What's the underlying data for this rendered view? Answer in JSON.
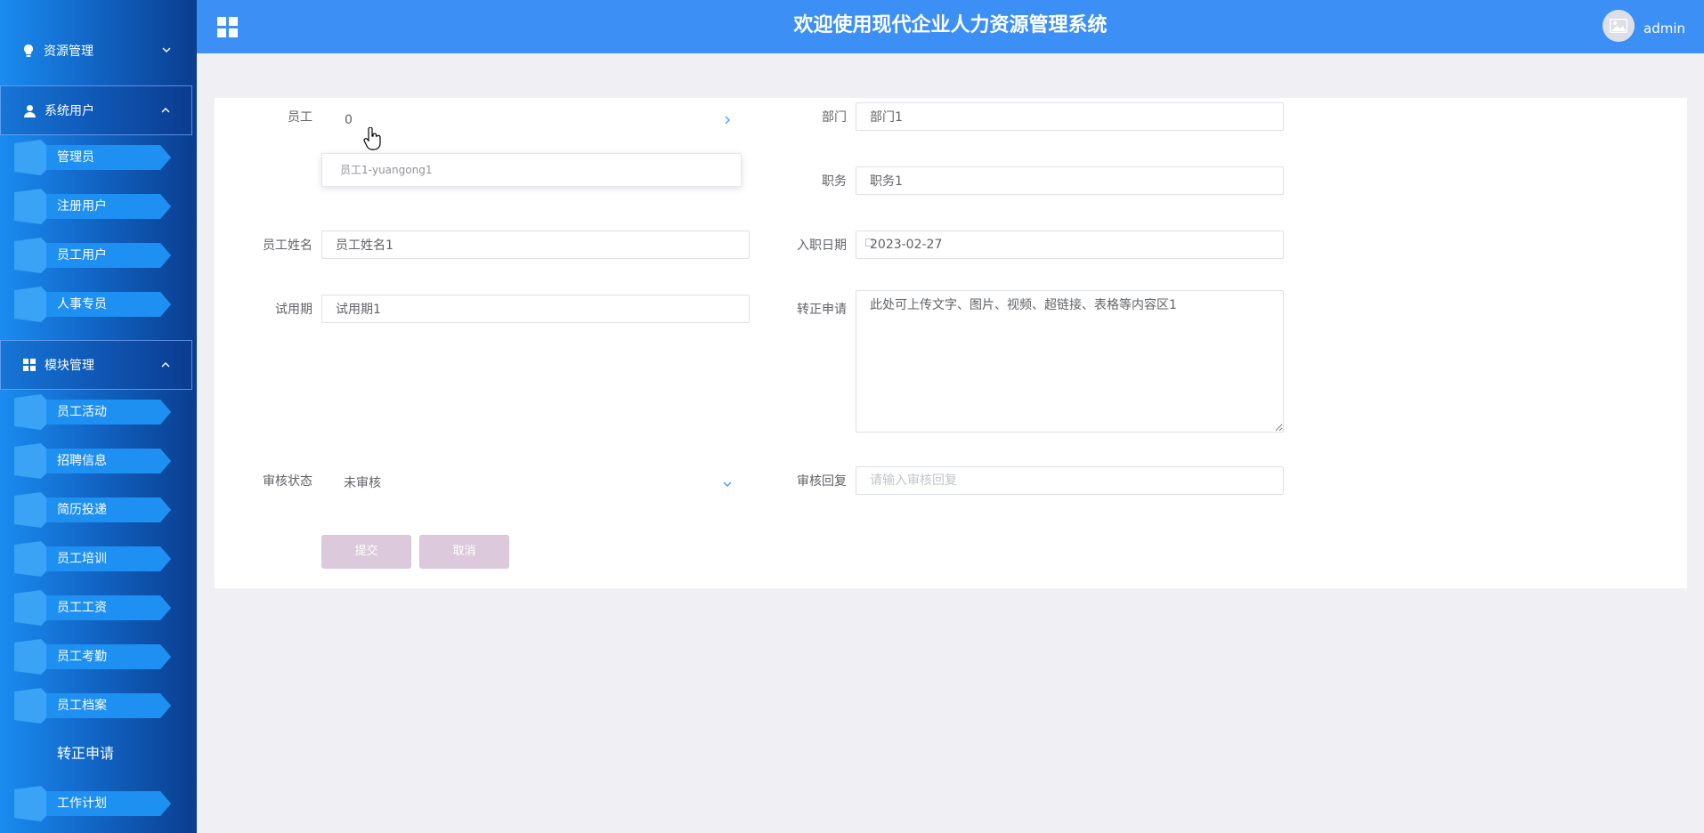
{
  "header": {
    "title": "欢迎使用现代企业人力资源管理系统",
    "username": "admin"
  },
  "sidebar": {
    "groups": [
      {
        "label": "资源管理",
        "icon": "lightbulb-icon"
      },
      {
        "label": "系统用户",
        "icon": "user-icon"
      },
      {
        "label": "模块管理",
        "icon": "grid-icon"
      }
    ],
    "system_users": [
      "管理员",
      "注册用户",
      "员工用户",
      "人事专员"
    ],
    "modules": [
      "员工活动",
      "招聘信息",
      "简历投递",
      "员工培训",
      "员工工资",
      "员工考勤",
      "员工档案"
    ],
    "current": "转正申请",
    "after": [
      "工作计划"
    ]
  },
  "form": {
    "employee": {
      "label": "员工",
      "value": "0",
      "options": [
        "员工1-yuangong1"
      ]
    },
    "department": {
      "label": "部门",
      "value": "部门1"
    },
    "position": {
      "label": "职务",
      "value": "职务1"
    },
    "name": {
      "label": "员工姓名",
      "value": "员工姓名1"
    },
    "hire_date": {
      "label": "入职日期",
      "value": "2023-02-27"
    },
    "probation": {
      "label": "试用期",
      "value": "试用期1"
    },
    "application": {
      "label": "转正申请",
      "value": "此处可上传文字、图片、视频、超链接、表格等内容区1"
    },
    "review_status": {
      "label": "审核状态",
      "value": "未审核"
    },
    "review_reply": {
      "label": "审核回复",
      "placeholder": "请输入审核回复"
    },
    "submit_label": "提交",
    "cancel_label": "取消"
  },
  "colors": {
    "header": "#3b8ff5",
    "sidebar_start": "#1a8cf0",
    "sidebar_end": "#0a3d8f",
    "button": "#dcc9dc",
    "accent": "#409eff"
  }
}
